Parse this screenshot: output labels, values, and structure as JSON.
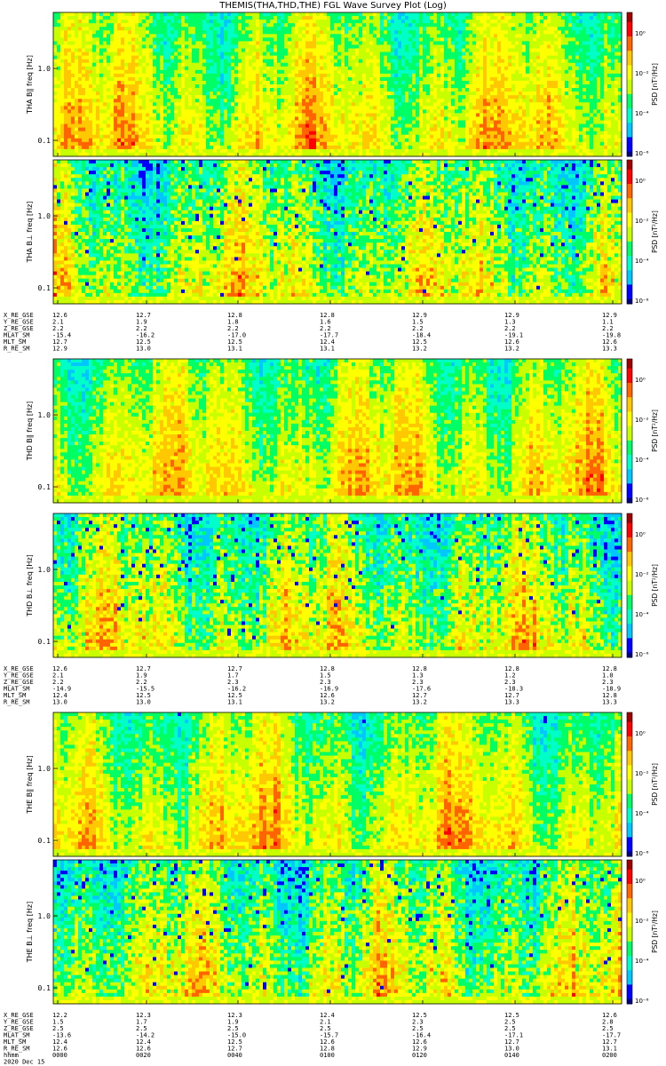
{
  "title": "THEMIS(THA,THD,THE) FGL Wave Survey Plot (Log)",
  "colors": {
    "scale": [
      "#000080",
      "#0000ff",
      "#00c8ff",
      "#00ffc8",
      "#00ff64",
      "#c8ff00",
      "#ffff00",
      "#ffc800",
      "#ff6400",
      "#ff0000",
      "#a00000"
    ],
    "background": "#ffffff"
  },
  "chart_data": [
    {
      "type": "heatmap",
      "probe": "THA",
      "ylabel": "THA B∥ freq [Hz]",
      "yscale": "log",
      "ylim": [
        0.06,
        6
      ],
      "yticks": [
        "1.0",
        "0.1"
      ],
      "colorbar_label": "PSD [nT²/Hz]",
      "colorbar_ticks": [
        "10⁰",
        "10⁻²",
        "10⁻⁴",
        "10⁻⁶"
      ],
      "colorbar_scale": "log",
      "dominant_level": "green-yellow"
    },
    {
      "type": "heatmap",
      "probe": "THA",
      "ylabel": "THA B⊥ freq [Hz]",
      "yscale": "log",
      "ylim": [
        0.06,
        6
      ],
      "yticks": [
        "1.0",
        "0.1"
      ],
      "colorbar_label": "PSD [nT²/Hz]",
      "colorbar_ticks": [
        "10⁰",
        "10⁻²",
        "10⁻⁴",
        "10⁻⁶"
      ],
      "colorbar_scale": "log",
      "dominant_level": "green-cyan"
    },
    {
      "type": "heatmap",
      "probe": "THD",
      "ylabel": "THD B∥ freq [Hz]",
      "yscale": "log",
      "ylim": [
        0.06,
        6
      ],
      "yticks": [
        "1.0",
        "0.1"
      ],
      "colorbar_label": "PSD [nT²/Hz]",
      "colorbar_ticks": [
        "10⁰",
        "10⁻²",
        "10⁻⁴",
        "10⁻⁶"
      ],
      "colorbar_scale": "log",
      "dominant_level": "green-yellow"
    },
    {
      "type": "heatmap",
      "probe": "THD",
      "ylabel": "THD B⊥ freq [Hz]",
      "yscale": "log",
      "ylim": [
        0.06,
        6
      ],
      "yticks": [
        "1.0",
        "0.1"
      ],
      "colorbar_label": "PSD [nT²/Hz]",
      "colorbar_ticks": [
        "10⁰",
        "10⁻²",
        "10⁻⁴",
        "10⁻⁶"
      ],
      "colorbar_scale": "log",
      "dominant_level": "green-cyan"
    },
    {
      "type": "heatmap",
      "probe": "THE",
      "ylabel": "THE B∥ freq [Hz]",
      "yscale": "log",
      "ylim": [
        0.06,
        6
      ],
      "yticks": [
        "1.0",
        "0.1"
      ],
      "colorbar_label": "PSD [nT²/Hz]",
      "colorbar_ticks": [
        "10⁰",
        "10⁻²",
        "10⁻⁴",
        "10⁻⁶"
      ],
      "colorbar_scale": "log",
      "dominant_level": "green-yellow"
    },
    {
      "type": "heatmap",
      "probe": "THE",
      "ylabel": "THE B⊥ freq [Hz]",
      "yscale": "log",
      "ylim": [
        0.06,
        6
      ],
      "yticks": [
        "1.0",
        "0.1"
      ],
      "colorbar_label": "PSD [nT²/Hz]",
      "colorbar_ticks": [
        "10⁰",
        "10⁻²",
        "10⁻⁴",
        "10⁻⁶"
      ],
      "colorbar_scale": "log",
      "dominant_level": "green-cyan"
    }
  ],
  "ephemeris": [
    {
      "probe": "THA",
      "rows": [
        {
          "label": "X_RE_GSE",
          "values": [
            "12.6",
            "12.7",
            "12.8",
            "12.8",
            "12.9",
            "12.9",
            "12.9"
          ]
        },
        {
          "label": "Y_RE_GSE",
          "values": [
            "2.1",
            "1.9",
            "1.8",
            "1.6",
            "1.5",
            "1.3",
            "1.1"
          ]
        },
        {
          "label": "Z_RE_GSE",
          "values": [
            "2.2",
            "2.2",
            "2.2",
            "2.2",
            "2.2",
            "2.2",
            "2.2"
          ]
        },
        {
          "label": "MLAT_SM",
          "values": [
            "-15.4",
            "-16.2",
            "-17.0",
            "-17.7",
            "-18.4",
            "-19.1",
            "-19.8"
          ]
        },
        {
          "label": "MLT_SM",
          "values": [
            "12.7",
            "12.5",
            "12.5",
            "12.4",
            "12.5",
            "12.6",
            "12.6"
          ]
        },
        {
          "label": "R_RE_SM",
          "values": [
            "12.9",
            "13.0",
            "13.1",
            "13.1",
            "13.2",
            "13.2",
            "13.3"
          ]
        }
      ]
    },
    {
      "probe": "THD",
      "rows": [
        {
          "label": "X_RE_GSE",
          "values": [
            "12.6",
            "12.7",
            "12.7",
            "12.8",
            "12.8",
            "12.8",
            "12.8"
          ]
        },
        {
          "label": "Y_RE_GSE",
          "values": [
            "2.1",
            "1.9",
            "1.7",
            "1.5",
            "1.3",
            "1.2",
            "1.0"
          ]
        },
        {
          "label": "Z_RE_GSE",
          "values": [
            "2.2",
            "2.2",
            "2.3",
            "2.3",
            "2.3",
            "2.3",
            "2.3"
          ]
        },
        {
          "label": "MLAT_SM",
          "values": [
            "-14.9",
            "-15.5",
            "-16.2",
            "-16.9",
            "-17.6",
            "-18.3",
            "-18.9"
          ]
        },
        {
          "label": "MLT_SM",
          "values": [
            "12.4",
            "12.5",
            "12.5",
            "12.6",
            "12.7",
            "12.7",
            "12.8"
          ]
        },
        {
          "label": "R_RE_SM",
          "values": [
            "13.0",
            "13.0",
            "13.1",
            "13.2",
            "13.2",
            "13.3",
            "13.3"
          ]
        }
      ]
    },
    {
      "probe": "THE",
      "rows": [
        {
          "label": "X_RE_GSE",
          "values": [
            "12.2",
            "12.3",
            "12.3",
            "12.4",
            "12.5",
            "12.5",
            "12.6"
          ]
        },
        {
          "label": "Y_RE_GSE",
          "values": [
            "1.5",
            "1.7",
            "1.9",
            "2.1",
            "2.3",
            "2.5",
            "2.8"
          ]
        },
        {
          "label": "Z_RE_GSE",
          "values": [
            "2.5",
            "2.5",
            "2.5",
            "2.5",
            "2.5",
            "2.5",
            "2.5"
          ]
        },
        {
          "label": "MLAT_SM",
          "values": [
            "-13.6",
            "-14.2",
            "-15.0",
            "-15.7",
            "-16.4",
            "-17.1",
            "-17.7"
          ]
        },
        {
          "label": "MLT_SM",
          "values": [
            "12.4",
            "12.4",
            "12.5",
            "12.6",
            "12.6",
            "12.7",
            "12.7"
          ]
        },
        {
          "label": "R_RE_SM",
          "values": [
            "12.6",
            "12.6",
            "12.7",
            "12.8",
            "12.9",
            "13.0",
            "13.1"
          ]
        },
        {
          "label": "hhmm",
          "values": [
            "0000",
            "0020",
            "0040",
            "0100",
            "0120",
            "0140",
            "0200"
          ]
        },
        {
          "label": "2020 Dec 15",
          "values": []
        }
      ]
    }
  ]
}
